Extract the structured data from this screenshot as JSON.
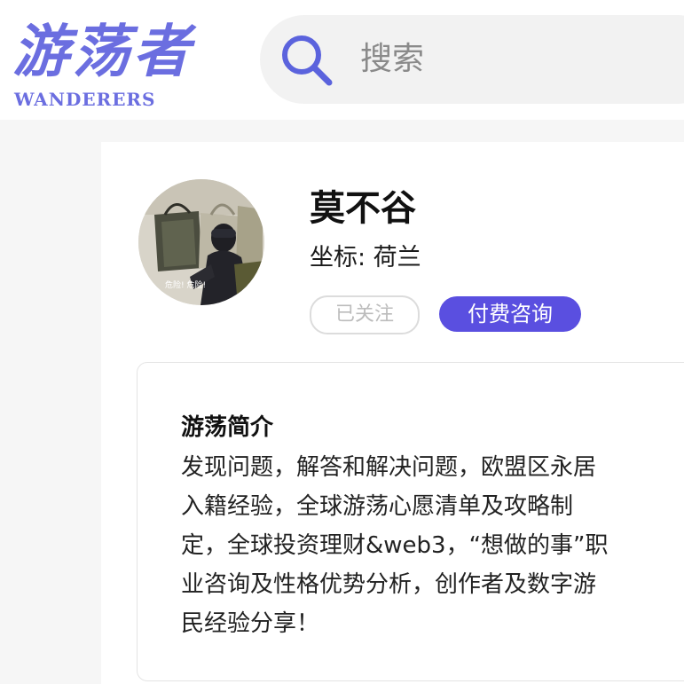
{
  "brand": {
    "logo_cn": "游荡者",
    "logo_en": "WANDERERS"
  },
  "search": {
    "placeholder": "搜索",
    "icon": "search-icon"
  },
  "profile": {
    "name": "莫不谷",
    "location": "坐标: 荷兰",
    "avatar_caption": "危险! 危险!",
    "follow_button": "已关注",
    "consult_button": "付费咨询"
  },
  "intro": {
    "title": "游荡简介",
    "lines": [
      "发现问题，解答和解决问题，欧盟区永居",
      "入籍经验，全球游荡心愿清单及攻略制",
      "定，全球投资理财&web3，“想做的事”职",
      "业咨询及性格优势分析，创作者及数字游",
      "民经验分享！"
    ]
  },
  "colors": {
    "brand": "#6b6ee0",
    "accent": "#5a4fe0",
    "search_bg": "#f2f2f2",
    "page_bg": "#f6f6f6"
  }
}
